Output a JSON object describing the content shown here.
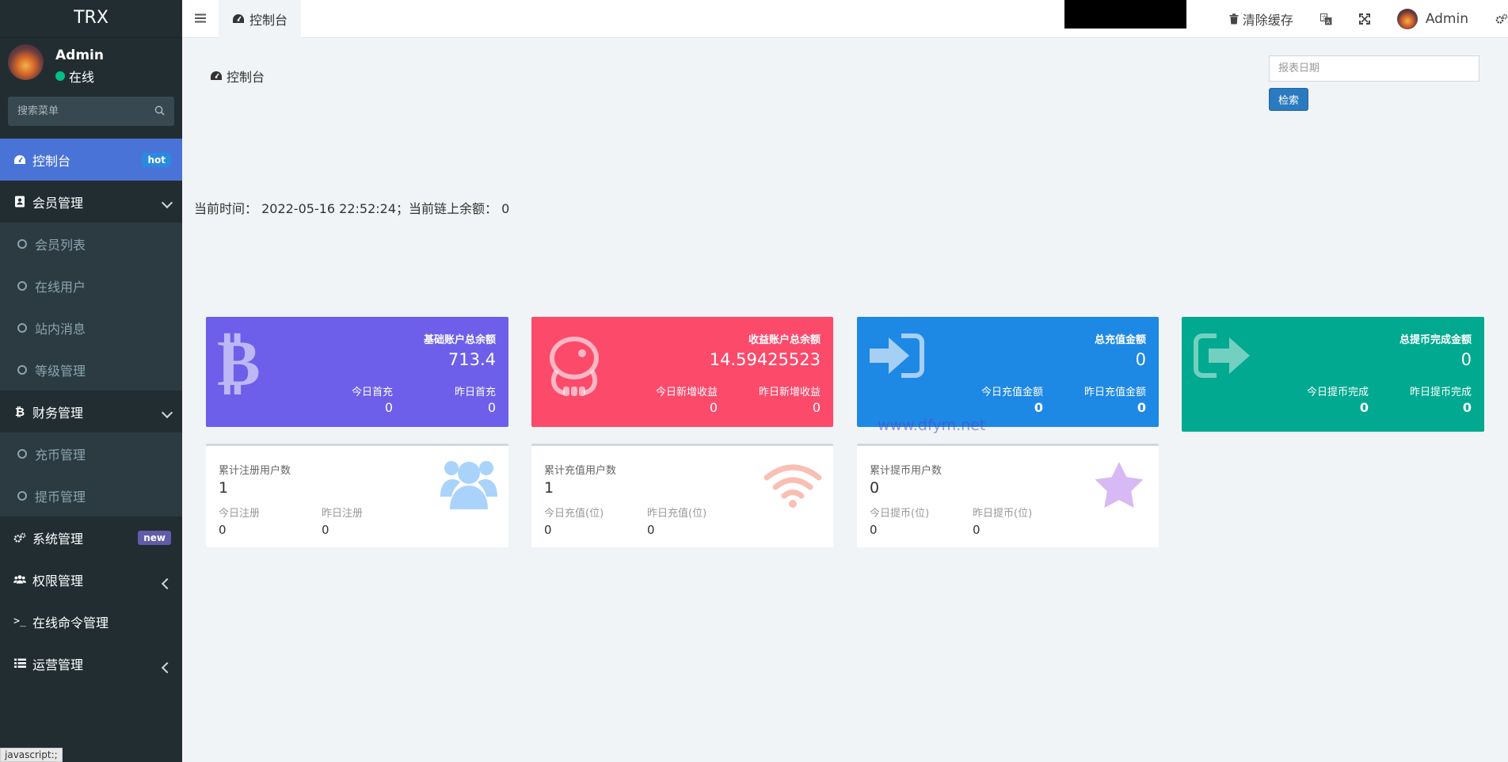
{
  "app": {
    "title": "TRX"
  },
  "user": {
    "name": "Admin",
    "status": "在线"
  },
  "sidebar": {
    "search_placeholder": "搜索菜单",
    "items": [
      {
        "label": "控制台",
        "badge": "hot"
      },
      {
        "label": "会员管理"
      },
      {
        "label": "会员列表"
      },
      {
        "label": "在线用户"
      },
      {
        "label": "站内消息"
      },
      {
        "label": "等级管理"
      },
      {
        "label": "财务管理"
      },
      {
        "label": "充币管理"
      },
      {
        "label": "提币管理"
      },
      {
        "label": "系统管理",
        "badge": "new"
      },
      {
        "label": "权限管理"
      },
      {
        "label": "在线命令管理"
      },
      {
        "label": "运营管理"
      }
    ]
  },
  "statusbar": {
    "text": "javascript:;"
  },
  "topbar": {
    "tab_label": "控制台",
    "clear_cache": "清除缓存",
    "user_name": "Admin"
  },
  "content": {
    "page_title": "控制台",
    "date_placeholder": "报表日期",
    "search_button": "检索",
    "time_line": "当前时间： 2022-05-16 22:52:24；当前链上余额： 0"
  },
  "cards": [
    {
      "title": "基础账户总余额",
      "value": "713.4",
      "sub1_label": "今日首充",
      "sub1_value": "0",
      "sub2_label": "昨日首充",
      "sub2_value": "0",
      "color": "#6d5fe9"
    },
    {
      "title": "收益账户总余额",
      "value": "14.59425523",
      "sub1_label": "今日新增收益",
      "sub1_value": "0",
      "sub2_label": "昨日新增收益",
      "sub2_value": "0",
      "color": "#fc4a6b"
    },
    {
      "title": "总充值金额",
      "value": "0",
      "sub1_label": "今日充值金额",
      "sub1_value": "0",
      "sub2_label": "昨日充值金额",
      "sub2_value": "0",
      "color": "#1e88e5"
    },
    {
      "title": "总提币完成金额",
      "value": "0",
      "sub1_label": "今日提币完成",
      "sub1_value": "0",
      "sub2_label": "昨日提币完成",
      "sub2_value": "0",
      "color": "#00a98f"
    }
  ],
  "small_cards": [
    {
      "title": "累计注册用户数",
      "value": "1",
      "sub1_label": "今日注册",
      "sub1_value": "0",
      "sub2_label": "昨日注册",
      "sub2_value": "0"
    },
    {
      "title": "累计充值用户数",
      "value": "1",
      "sub1_label": "今日充值(位)",
      "sub1_value": "0",
      "sub2_label": "昨日充值(位)",
      "sub2_value": "0"
    },
    {
      "title": "累计提币用户数",
      "value": "0",
      "sub1_label": "今日提币(位)",
      "sub1_value": "0",
      "sub2_label": "昨日提币(位)",
      "sub2_value": "0"
    }
  ],
  "watermark": "www.dfym.net"
}
